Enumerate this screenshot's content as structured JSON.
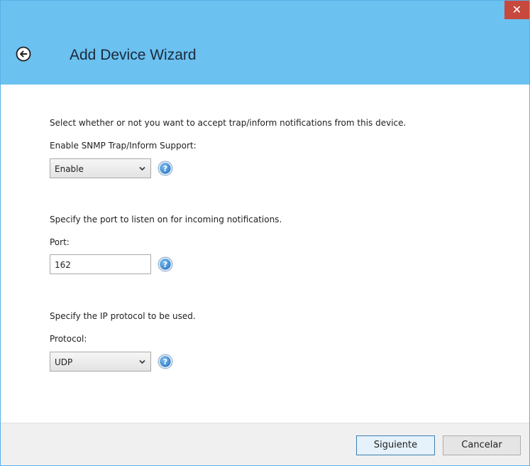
{
  "window": {
    "title": "Add Device Wizard",
    "close_label": "✕"
  },
  "trap": {
    "instruction": "Select whether or not you want to accept trap/inform notifications from this device.",
    "label": "Enable SNMP Trap/Inform Support:",
    "selected": "Enable"
  },
  "port": {
    "instruction": "Specify the port to listen on for incoming notifications.",
    "label": "Port:",
    "value": "162"
  },
  "protocol": {
    "instruction": "Specify the IP protocol to be used.",
    "label": "Protocol:",
    "selected": "UDP"
  },
  "footer": {
    "next_label": "Siguiente",
    "cancel_label": "Cancelar"
  },
  "colors": {
    "titlebar": "#6bc1f0",
    "close_button": "#c7483d",
    "help_icon": "#2f78c4"
  }
}
